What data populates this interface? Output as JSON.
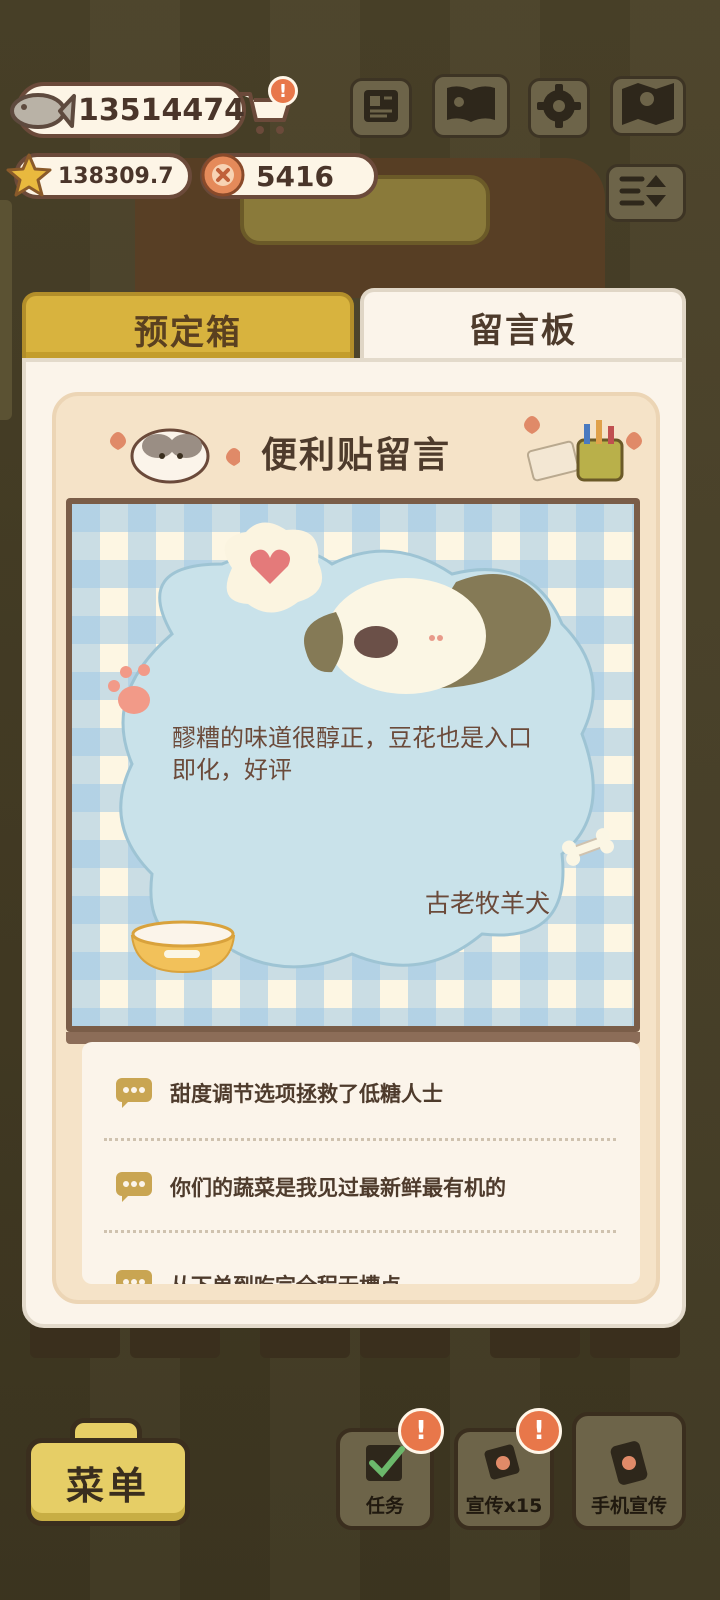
{
  "resources": {
    "fish": "13514474",
    "stars": "138309.7",
    "coins": "5416",
    "cart_alert": "!"
  },
  "top_buttons": [
    "newspaper-icon",
    "book-icon",
    "gear-icon",
    "map-icon",
    "sort-icon"
  ],
  "tabs": {
    "reserve": "预定箱",
    "board": "留言板"
  },
  "board": {
    "title": "便利贴留言",
    "note": {
      "text": "醪糟的味道很醇正，豆花也是入口即化，好评",
      "author": "古老牧羊犬"
    },
    "comments": [
      "甜度调节选项拯救了低糖人士",
      "你们的蔬菜是我见过最新鲜最有机的",
      "从下单到吃完全程无槽点"
    ]
  },
  "bottom": {
    "menu": "菜单",
    "tasks": "任务",
    "promote": "宣传x15",
    "phone_promote": "手机宣传",
    "alert": "!"
  },
  "colors": {
    "accent_gold": "#d8b33e",
    "alert_orange": "#e8774a",
    "panel_cream": "#fbf4ea"
  }
}
